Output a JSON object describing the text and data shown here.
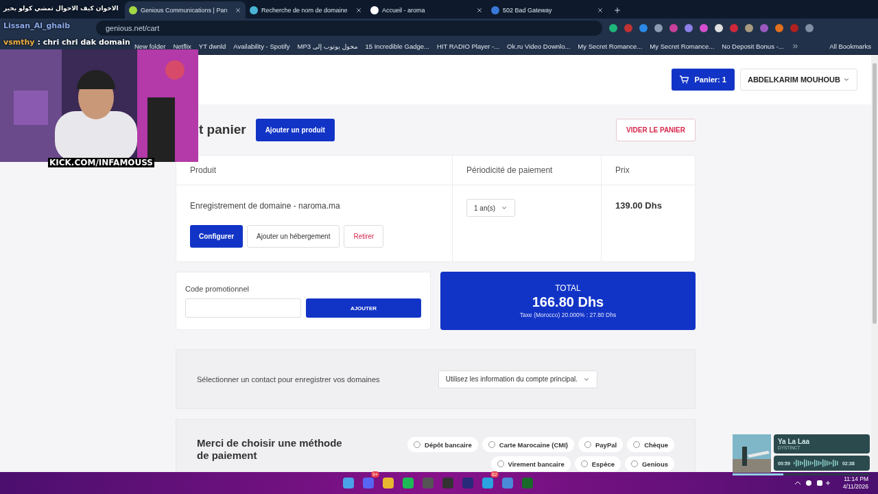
{
  "browser": {
    "tabs": [
      {
        "title": "Genious Communications | Pan",
        "selected": true
      },
      {
        "title": "Recherche de nom de domaine",
        "selected": false
      },
      {
        "title": "Accueil - aroma",
        "selected": false
      },
      {
        "title": "502 Bad Gateway",
        "selected": false
      }
    ],
    "address": "genious.net/cart",
    "bookmarks": [
      "New folder",
      "Netflix",
      "YT  dwnld",
      "Availability - Spotify",
      "MP3 محول يوتوب إلى",
      "15 Incredible Gadge...",
      "HIT RADIO Player -...",
      "Ok.ru Video Downlo...",
      "My Secret Romance...",
      "My Secret Romance...",
      "No Deposit Bonus -..."
    ],
    "all_bookmarks": "All Bookmarks"
  },
  "stream_overlay": {
    "chat": [
      {
        "message": "الاخوان كيف الاحوال تمشي كولو بخير"
      },
      {
        "user": "Lissan_Al_ghaib"
      },
      {
        "user": "vsmthy",
        "message": ": chri chri dak domain"
      }
    ],
    "caption": "KICK.COM/INFAMOUSS"
  },
  "header": {
    "cart_button": "Panier: 1",
    "user_menu": "ABDELKARIM MOUHOUB"
  },
  "cart": {
    "title": "t panier",
    "add_button": "Ajouter un produit",
    "empty_button": "VIDER LE PANIER",
    "columns": [
      "Produit",
      "Périodicité de paiement",
      "Prix"
    ],
    "items": [
      {
        "product": "Enregistrement de domaine - naroma.ma",
        "cycle": "1 an(s)",
        "price": "139.00 Dhs",
        "actions": [
          "Configurer",
          "Ajouter un hébergement",
          "Retirer"
        ]
      }
    ]
  },
  "promo": {
    "label": "Code promotionnel",
    "button": "AJOUTER"
  },
  "total": {
    "label": "TOTAL",
    "amount": "166.80 Dhs",
    "tax": "Taxe (Morocco) 20.000% : 27.80 Dhs"
  },
  "contact": {
    "label": "Sélectionner un contact pour enregistrer vos domaines",
    "select": "Utilisez les information du compte principal."
  },
  "payment": {
    "title": "Merci de choisir une méthode de paiement",
    "methods": [
      {
        "label": "Dépôt bancaire",
        "selected": false
      },
      {
        "label": "Carte Marocaine (CMI)",
        "selected": false
      },
      {
        "label": "PayPal",
        "selected": false
      },
      {
        "label": "Chèque",
        "selected": false
      },
      {
        "label": "Virement bancaire",
        "selected": false
      },
      {
        "label": "Espèce",
        "selected": false
      },
      {
        "label": "Genious",
        "selected": false
      }
    ]
  },
  "music": {
    "title": "Ya La Laa",
    "artist": "DYSTINCT",
    "elapsed": "00:59",
    "duration": "02:38",
    "level": 0.37
  },
  "taskbar": {
    "badges": [
      "9+",
      "82"
    ],
    "time": "11:14 PM",
    "date": "4/11/2026"
  }
}
